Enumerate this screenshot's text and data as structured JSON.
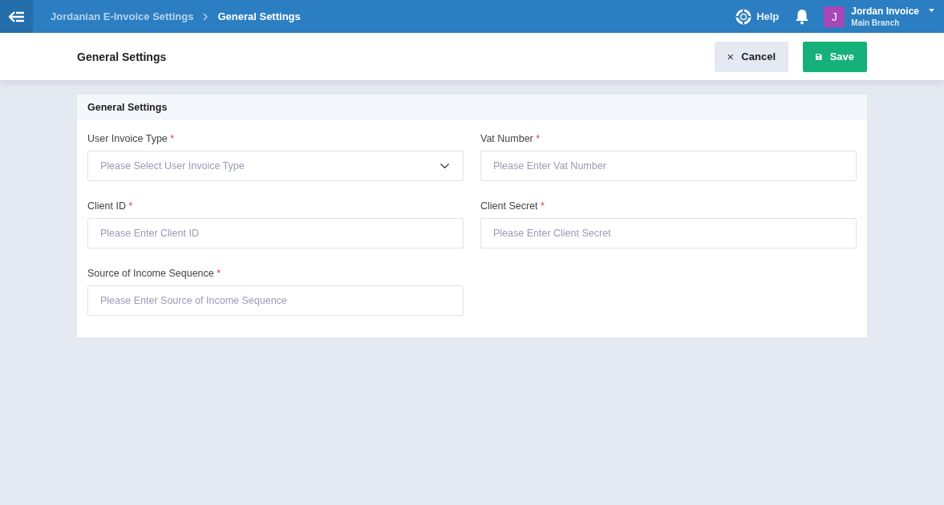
{
  "topbar": {
    "breadcrumb": [
      {
        "label": "Jordanian E-Invoice Settings",
        "current": false
      },
      {
        "label": "General Settings",
        "current": true
      }
    ],
    "help": "Help",
    "user": {
      "initial": "J",
      "name": "Jordan Invoice",
      "branch": "Main Branch"
    }
  },
  "header": {
    "title": "General Settings",
    "buttons": [
      {
        "label": "Cancel",
        "kind": "cancel"
      },
      {
        "label": "Save",
        "kind": "save"
      }
    ]
  },
  "card": {
    "title": "General Settings",
    "fields": [
      {
        "label": "User Invoice Type",
        "required_mark": "*",
        "kind": "select",
        "placeholder": "Please Select User Invoice Type"
      },
      {
        "label": "Vat Number",
        "required_mark": "*",
        "kind": "text",
        "placeholder": "Please Enter Vat Number"
      },
      {
        "label": "Client ID",
        "required_mark": "*",
        "kind": "text",
        "placeholder": "Please Enter Client ID"
      },
      {
        "label": "Client Secret",
        "required_mark": "*",
        "kind": "text",
        "placeholder": "Please Enter Client Secret"
      },
      {
        "label": "Source of Income Sequence",
        "required_mark": "*",
        "kind": "text",
        "placeholder": "Please Enter Source of Income Sequence"
      }
    ]
  }
}
